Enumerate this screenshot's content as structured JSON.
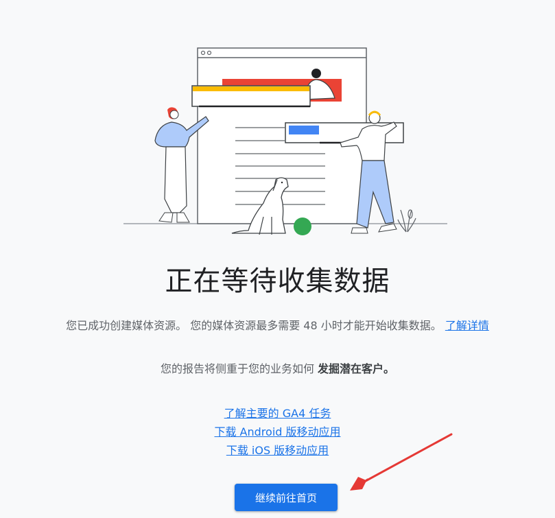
{
  "main": {
    "title": "正在等待收集数据",
    "description": "您已成功创建媒体资源。 您的媒体资源最多需要 48 小时才能开始收集数据。",
    "learn_more_link": "了解详情",
    "focus_prefix": "您的报告将侧重于您的业务如何",
    "focus_emphasis": "发掘潜在客户。"
  },
  "links": {
    "ga4_tasks": "了解主要的 GA4 任务",
    "android_app": "下载 Android 版移动应用",
    "ios_app": "下载 iOS 版移动应用"
  },
  "button": {
    "continue_label": "继续前往首页"
  },
  "colors": {
    "primary": "#1a73e8",
    "annotation_arrow": "#e53935",
    "illustration_red": "#ea4335",
    "illustration_yellow": "#fbbc04",
    "illustration_green": "#34a853",
    "illustration_blue": "#4285f4"
  }
}
